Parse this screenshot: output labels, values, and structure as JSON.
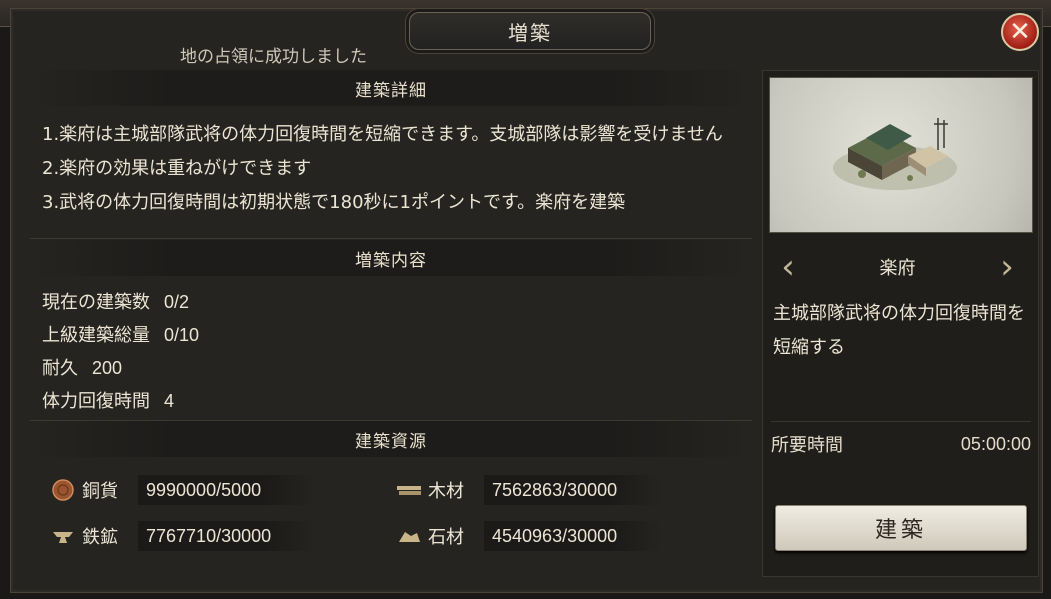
{
  "window": {
    "title": "増築",
    "notice": "地の占領に成功しました"
  },
  "details": {
    "header": "建築詳細",
    "lines": [
      "1.楽府は主城部隊武将の体力回復時間を短縮できます。支城部隊は影響を受けません",
      "2.楽府の効果は重ねがけできます",
      "3.武将の体力回復時間は初期状態で180秒に1ポイントです。楽府を建築"
    ]
  },
  "content": {
    "header": "増築内容",
    "stats": [
      {
        "label": "現在の建築数",
        "value": "0/2"
      },
      {
        "label": "上級建築総量",
        "value": "0/10"
      },
      {
        "label": "耐久",
        "value": "200"
      },
      {
        "label": "体力回復時間",
        "value": "4"
      }
    ]
  },
  "resources": {
    "header": "建築資源",
    "items": [
      {
        "name": "銅貨",
        "value": "9990000/5000",
        "icon": "coin-icon",
        "color": "#b4673a"
      },
      {
        "name": "木材",
        "value": "7562863/30000",
        "icon": "wood-icon",
        "color": "#c9b48a"
      },
      {
        "name": "鉄鉱",
        "value": "7767710/30000",
        "icon": "iron-icon",
        "color": "#c9b48a"
      },
      {
        "name": "石材",
        "value": "4540963/30000",
        "icon": "stone-icon",
        "color": "#c9b48a"
      }
    ]
  },
  "building": {
    "name": "楽府",
    "description": "主城部隊武将の体力回復時間を短縮する",
    "time_label": "所要時間",
    "time_value": "05:00:00",
    "build_button": "建築"
  },
  "icons": {
    "close": "close-icon",
    "prev": "chevron-left-icon",
    "next": "chevron-right-icon"
  },
  "colors": {
    "close_button": "#c23a2a",
    "panel": "#252421",
    "text": "#ece5d4"
  }
}
